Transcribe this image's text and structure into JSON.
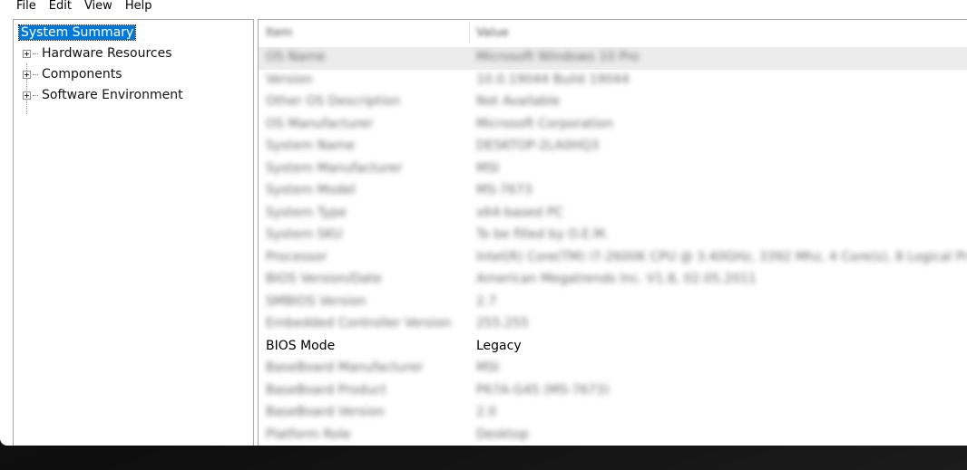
{
  "menu": [
    "File",
    "Edit",
    "View",
    "Help"
  ],
  "tree": {
    "items": [
      {
        "label": "System Summary",
        "selected": true,
        "expandable": false
      },
      {
        "label": "Hardware Resources",
        "selected": false,
        "expandable": true
      },
      {
        "label": "Components",
        "selected": false,
        "expandable": true
      },
      {
        "label": "Software Environment",
        "selected": false,
        "expandable": true
      }
    ]
  },
  "list": {
    "columns": [
      "Item",
      "Value"
    ],
    "rows": [
      {
        "item": "OS Name",
        "value": "Microsoft Windows 10 Pro",
        "blurred": true
      },
      {
        "item": "Version",
        "value": "10.0.19044 Build 19044",
        "blurred": true
      },
      {
        "item": "Other OS Description",
        "value": "Not Available",
        "blurred": true
      },
      {
        "item": "OS Manufacturer",
        "value": "Microsoft Corporation",
        "blurred": true
      },
      {
        "item": "System Name",
        "value": "DESKTOP-2LA0HQ3",
        "blurred": true
      },
      {
        "item": "System Manufacturer",
        "value": "MSI",
        "blurred": true
      },
      {
        "item": "System Model",
        "value": "MS-7673",
        "blurred": true
      },
      {
        "item": "System Type",
        "value": "x64-based PC",
        "blurred": true
      },
      {
        "item": "System SKU",
        "value": "To be filled by O.E.M.",
        "blurred": true
      },
      {
        "item": "Processor",
        "value": "Intel(R) Core(TM) i7-2600K CPU @ 3.40GHz, 3392 Mhz, 4 Core(s), 8 Logical Pr...",
        "blurred": true
      },
      {
        "item": "BIOS Version/Date",
        "value": "American Megatrends Inc. V1.8, 02.05.2011",
        "blurred": true
      },
      {
        "item": "SMBIOS Version",
        "value": "2.7",
        "blurred": true
      },
      {
        "item": "Embedded Controller Version",
        "value": "255.255",
        "blurred": true
      },
      {
        "item": "BIOS Mode",
        "value": "Legacy",
        "blurred": false
      },
      {
        "item": "BaseBoard Manufacturer",
        "value": "MSI",
        "blurred": true
      },
      {
        "item": "BaseBoard Product",
        "value": "P67A-G45 (MS-7673)",
        "blurred": true
      },
      {
        "item": "BaseBoard Version",
        "value": "2.0",
        "blurred": true
      },
      {
        "item": "Platform Role",
        "value": "Desktop",
        "blurred": true
      }
    ]
  },
  "colors": {
    "selection": "#0078d7",
    "first_row": "#ececec",
    "border": "#a9a9a9"
  }
}
